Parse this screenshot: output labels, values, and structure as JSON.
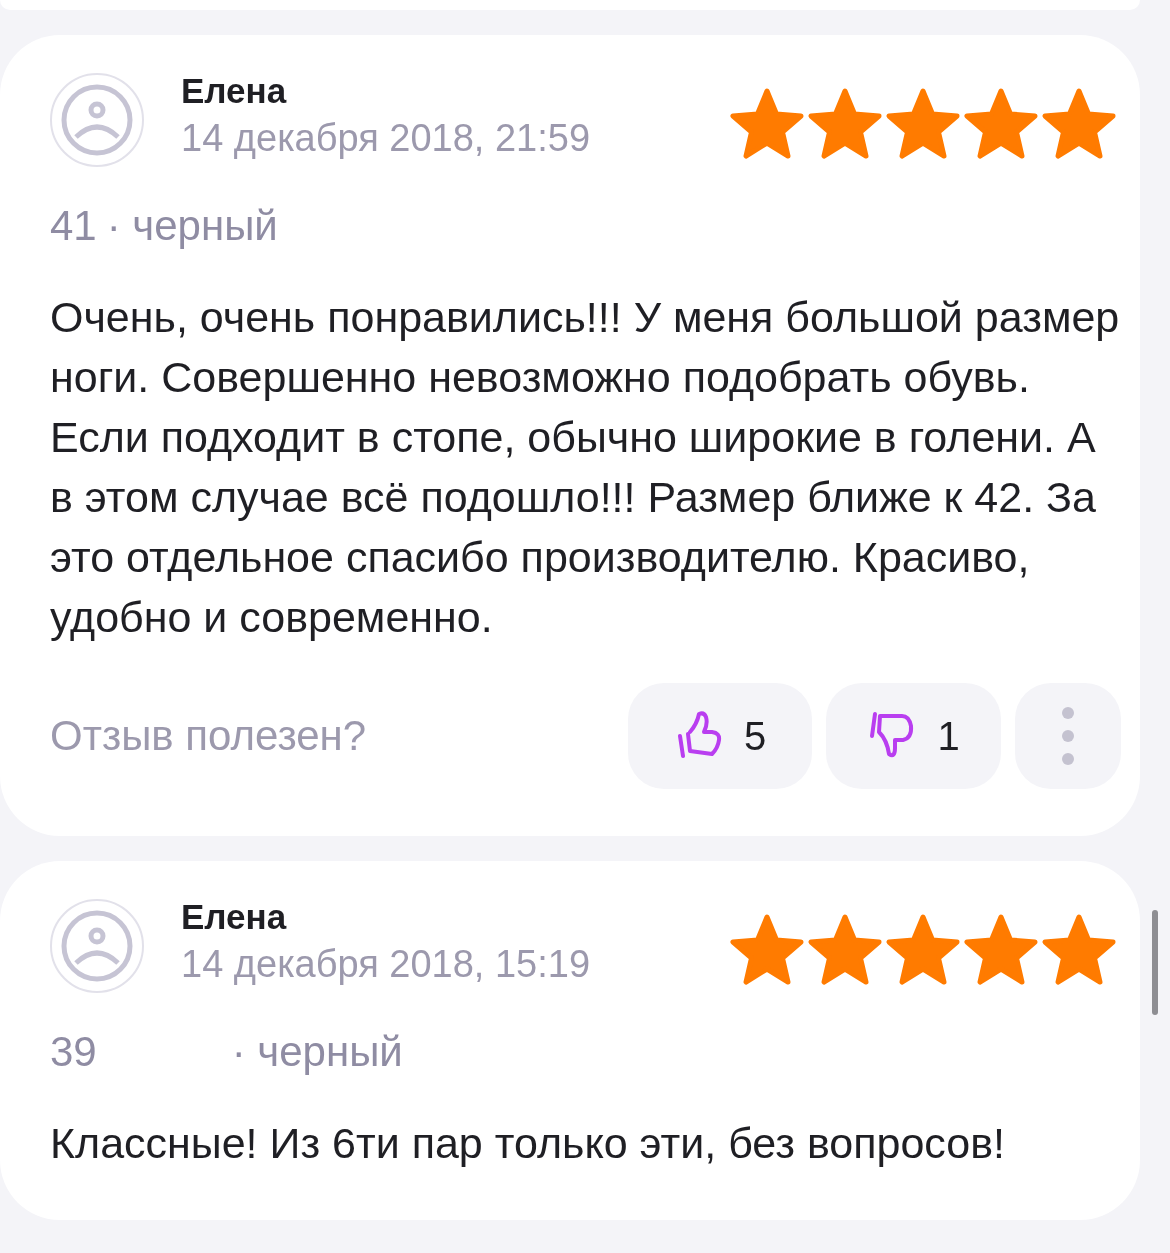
{
  "reviews": [
    {
      "author": "Елена",
      "date": "14 декабря 2018, 21:59",
      "stars": 5,
      "size": "41",
      "color_name": "· черный",
      "wide_gap": false,
      "text": "Очень, очень понравились!!! У меня большой размер ноги. Совершенно невозможно подобрать обувь. Если подходит в стопе, обычно широкие в голени. А в этом случае всё подошло!!! Размер ближе к 42. За это отдельное спасибо производителю. Красиво, удобно и современно.",
      "helpful_label": "Отзыв полезен?",
      "likes": "5",
      "dislikes": "1"
    },
    {
      "author": "Елена",
      "date": "14 декабря 2018, 15:19",
      "stars": 5,
      "size": "39",
      "color_name": "· черный",
      "wide_gap": true,
      "text": "Классные! Из 6ти пар только эти, без вопросов!"
    }
  ]
}
